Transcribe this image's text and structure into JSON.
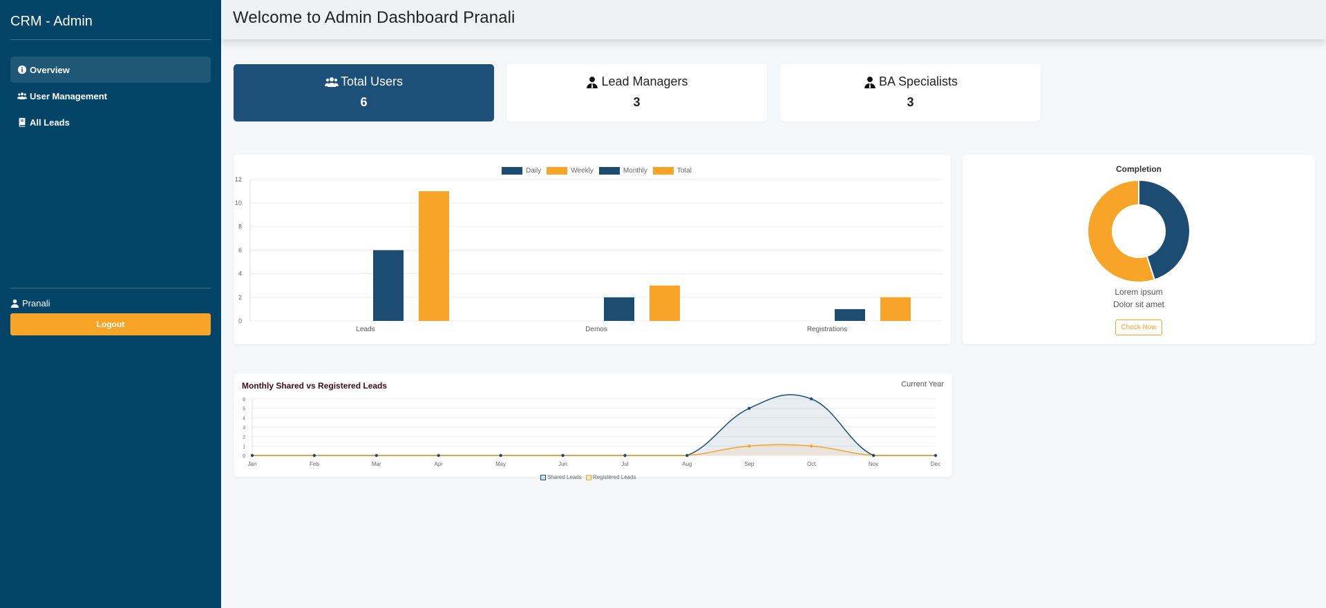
{
  "sidebar": {
    "brand": "CRM - Admin",
    "items": [
      {
        "label": "Overview",
        "icon": "info-circle-icon",
        "active": true
      },
      {
        "label": "User Management",
        "icon": "users-icon",
        "active": false
      },
      {
        "label": "All Leads",
        "icon": "book-icon",
        "active": false
      }
    ],
    "user_name": "Pranali",
    "logout_label": "Logout"
  },
  "header": {
    "title": "Welcome to Admin Dashboard Pranali"
  },
  "stats": [
    {
      "label": "Total Users",
      "value": "6",
      "icon": "users-icon"
    },
    {
      "label": "Lead Managers",
      "value": "3",
      "icon": "user-tie-icon"
    },
    {
      "label": "BA Specialists",
      "value": "3",
      "icon": "user-tie-icon"
    }
  ],
  "colors": {
    "navy": "#1d4c72",
    "orange": "#f8a429",
    "sidebar": "#034467"
  },
  "donut": {
    "title": "Completion",
    "text1": "Lorem ipsum",
    "text2": "Dolor sit amet",
    "button_label": "Check Now"
  },
  "line_panel": {
    "title": "Monthly Shared vs Registered Leads",
    "subtitle": "Current Year"
  },
  "chart_data": [
    {
      "type": "bar",
      "categories": [
        "Leads",
        "Demos",
        "Registrations"
      ],
      "series": [
        {
          "name": "Daily",
          "values": [
            0,
            0,
            0
          ],
          "color": "#1d4c72"
        },
        {
          "name": "Weekly",
          "values": [
            0,
            0,
            0
          ],
          "color": "#f8a429"
        },
        {
          "name": "Monthly",
          "values": [
            6,
            2,
            1
          ],
          "color": "#1d4c72"
        },
        {
          "name": "Total",
          "values": [
            11,
            3,
            2
          ],
          "color": "#f8a429"
        }
      ],
      "yticks": [
        "0",
        "2",
        "4",
        "6",
        "8",
        "10",
        "12"
      ],
      "ylim": [
        0,
        12
      ],
      "legend_position": "top"
    },
    {
      "type": "pie",
      "subtype": "doughnut",
      "title": "Completion",
      "values": [
        45,
        55
      ],
      "colors": [
        "#1d4c72",
        "#f8a429"
      ]
    },
    {
      "type": "line",
      "title": "Monthly Shared vs Registered Leads",
      "x": [
        "Jan",
        "Feb",
        "Mar",
        "Apr",
        "May",
        "Jun",
        "Jul",
        "Aug",
        "Sep",
        "Oct",
        "Nov",
        "Dec"
      ],
      "series": [
        {
          "name": "Shared Leads",
          "values": [
            0,
            0,
            0,
            0,
            0,
            0,
            0,
            0,
            5,
            6,
            0,
            0
          ],
          "color": "#1d4c72"
        },
        {
          "name": "Registered Leads",
          "values": [
            0,
            0,
            0,
            0,
            0,
            0,
            0,
            0,
            1,
            1,
            0,
            0
          ],
          "color": "#f8a429"
        }
      ],
      "yticks": [
        "0",
        "1",
        "2",
        "3",
        "4",
        "5",
        "6"
      ],
      "ylim": [
        0,
        6
      ],
      "legend_position": "bottom"
    }
  ]
}
